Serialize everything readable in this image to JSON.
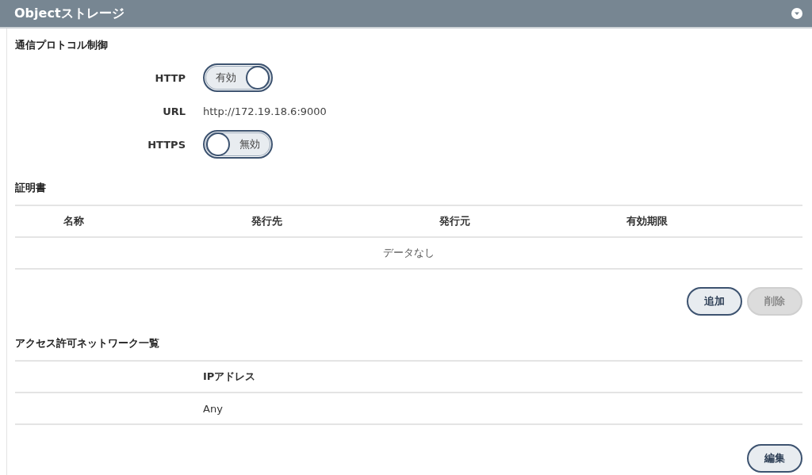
{
  "panel": {
    "title": "Objectストレージ",
    "expanded": true
  },
  "protocol": {
    "heading": "通信プロトコル制御",
    "rows": [
      {
        "kind": "toggle",
        "label": "HTTP",
        "on": true,
        "state_text": "有効"
      },
      {
        "kind": "text",
        "label": "URL",
        "value": "http://172.19.18.6:9000"
      },
      {
        "kind": "toggle",
        "label": "HTTPS",
        "on": false,
        "state_text": "無効"
      }
    ]
  },
  "certificates": {
    "heading": "証明書",
    "columns": [
      "名称",
      "発行先",
      "発行元",
      "有効期限"
    ],
    "empty_text": "データなし",
    "buttons": [
      {
        "label": "追加",
        "disabled": false
      },
      {
        "label": "削除",
        "disabled": true
      }
    ]
  },
  "networks": {
    "heading": "アクセス許可ネットワーク一覧",
    "columns": [
      "IPアドレス"
    ],
    "rows": [
      [
        "Any"
      ]
    ],
    "buttons": [
      {
        "label": "編集",
        "disabled": false
      }
    ]
  }
}
